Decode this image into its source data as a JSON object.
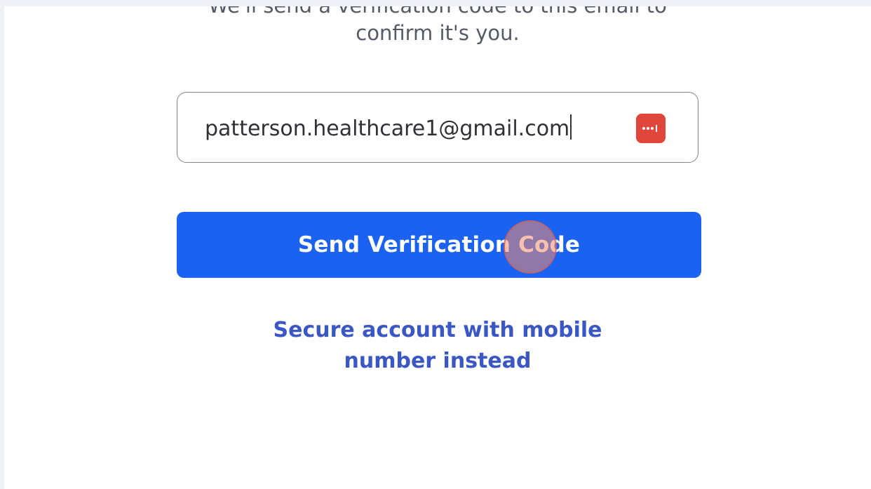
{
  "verify_email": {
    "subtitle_line1": "We'll send a verification code to this email to",
    "subtitle_line2": "confirm it's you.",
    "email_value": "patterson.healthcare1@gmail.com",
    "password_manager_icon": "password-manager-dots-icon",
    "send_button_label": "Send Verification Code",
    "alt_link_label": "Secure account with mobile number instead"
  },
  "colors": {
    "primary_button": "#1b62f0",
    "link": "#3a57c4",
    "password_manager_icon": "#e0463a",
    "click_indicator": "#f08c6e"
  }
}
